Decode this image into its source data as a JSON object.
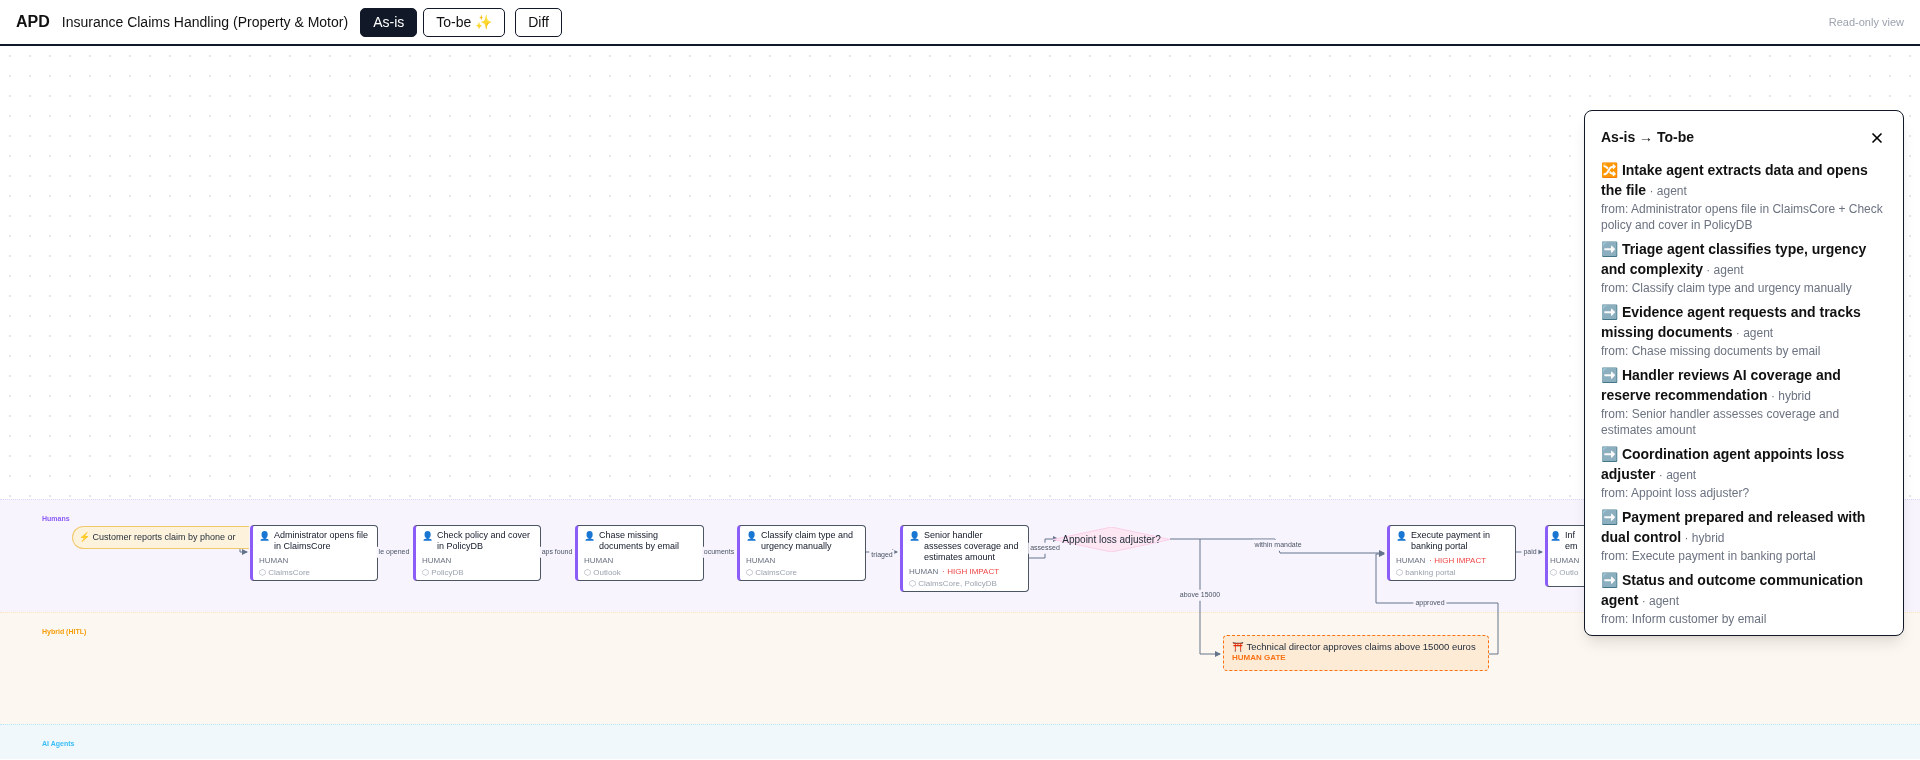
{
  "header": {
    "logo": "APD",
    "title": "Insurance Claims Handling (Property & Motor)",
    "view_tabs": [
      {
        "label": "As-is",
        "selected": true
      },
      {
        "label": "To-be ✨",
        "selected": false
      },
      {
        "label": "Diff",
        "selected": false
      }
    ],
    "note": "Read-only view"
  },
  "lanes": [
    {
      "label": "Humans",
      "kind": "human"
    },
    {
      "label": "Hybrid (HITL)",
      "kind": "hybrid"
    },
    {
      "label": "AI Agents",
      "kind": "agent"
    }
  ],
  "nodes": [
    {
      "kind": "trigger",
      "icon": "⚡",
      "title": "Customer reports claim by phone or"
    },
    {
      "kind": "task",
      "icon": "👤",
      "title": "Administrator opens file in ClaimsCore",
      "role": "HUMAN",
      "systems": "⬡ ClaimsCore"
    },
    {
      "kind": "task",
      "icon": "👤",
      "title": "Check policy and cover in PolicyDB",
      "role": "HUMAN",
      "systems": "⬡ PolicyDB"
    },
    {
      "kind": "task",
      "icon": "👤",
      "title": "Chase missing documents by email",
      "role": "HUMAN",
      "systems": "⬡ Outlook"
    },
    {
      "kind": "task",
      "icon": "👤",
      "title": "Classify claim type and urgency manually",
      "role": "HUMAN",
      "systems": "⬡ ClaimsCore"
    },
    {
      "kind": "task",
      "icon": "👤",
      "title": "Senior handler assesses coverage and estimates amount",
      "role": "HUMAN",
      "impact": "· HIGH IMPACT",
      "systems": "⬡ ClaimsCore, PolicyDB"
    },
    {
      "kind": "decision",
      "title": "Appoint loss adjuster?"
    },
    {
      "kind": "task",
      "icon": "👤",
      "title": "Execute payment in banking portal",
      "role": "HUMAN",
      "impact": "· HIGH IMPACT",
      "systems": "⬡ banking portal"
    },
    {
      "kind": "task",
      "icon": "👤",
      "title": "Inf em",
      "role": "HUMAN",
      "systems": "⬡ Outlo"
    },
    {
      "kind": "gate",
      "icon": "⛩️",
      "title": "Technical director approves claims above 15000 euros",
      "role": "HUMAN GATE"
    }
  ],
  "edges": [
    {
      "label": "le opened"
    },
    {
      "label": "aps found"
    },
    {
      "label": "ocuments"
    },
    {
      "label": "triaged"
    },
    {
      "label": "assessed"
    },
    {
      "label": "within mandate"
    },
    {
      "label": "above 15000"
    },
    {
      "label": "approved"
    },
    {
      "label": "paid"
    }
  ],
  "panel": {
    "title": "As-is → To-be",
    "changes": [
      {
        "icon": "🔀",
        "title": "Intake agent extracts data and opens the file",
        "mode": "· agent",
        "from": "from: Administrator opens file in ClaimsCore + Check policy and cover in PolicyDB"
      },
      {
        "icon": "➡️",
        "title": "Triage agent classifies type, urgency and complexity",
        "mode": "· agent",
        "from": "from: Classify claim type and urgency manually"
      },
      {
        "icon": "➡️",
        "title": "Evidence agent requests and tracks missing documents",
        "mode": "· agent",
        "from": "from: Chase missing documents by email"
      },
      {
        "icon": "➡️",
        "title": "Handler reviews AI coverage and reserve recommendation",
        "mode": "· hybrid",
        "from": "from: Senior handler assesses coverage and estimates amount"
      },
      {
        "icon": "➡️",
        "title": "Coordination agent appoints loss adjuster",
        "mode": "· agent",
        "from": "from: Appoint loss adjuster?"
      },
      {
        "icon": "➡️",
        "title": "Payment prepared and released with dual control",
        "mode": "· hybrid",
        "from": "from: Execute payment in banking portal"
      },
      {
        "icon": "➡️",
        "title": "Status and outcome communication agent",
        "mode": "· agent",
        "from": "from: Inform customer by email"
      }
    ]
  }
}
